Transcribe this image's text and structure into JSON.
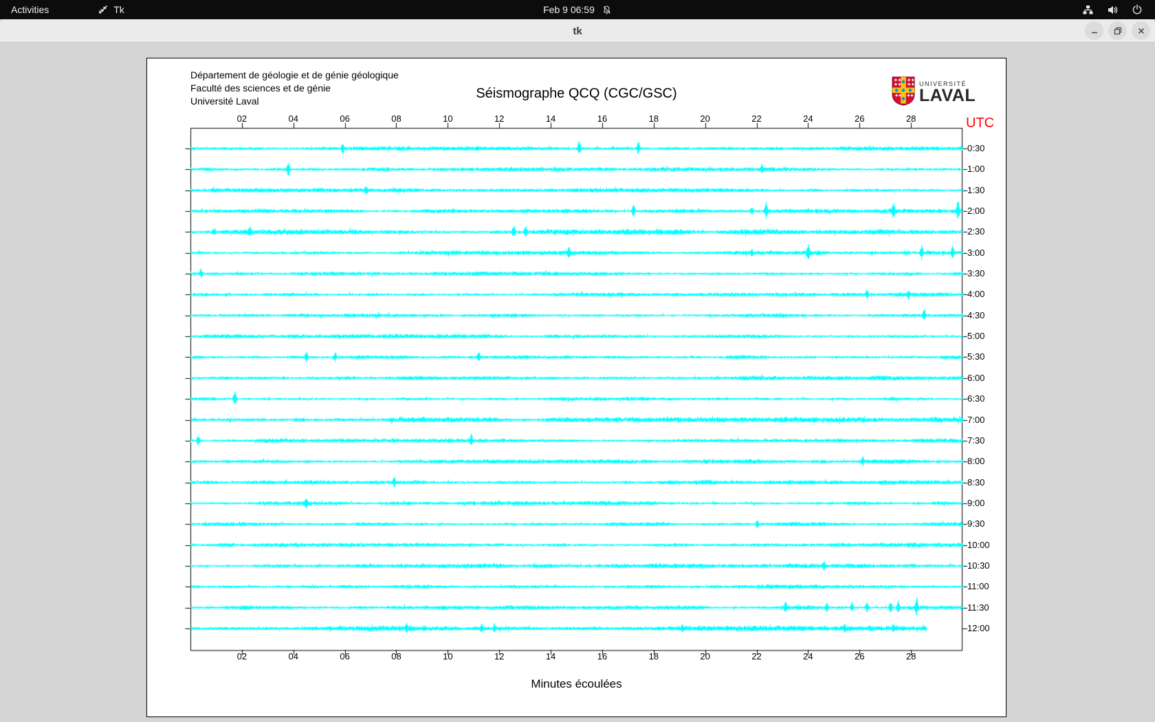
{
  "top_bar": {
    "activities_label": "Activities",
    "app_indicator_label": "Tk",
    "clock": "Feb 9  06:59",
    "icons": {
      "app": "tk-app-icon",
      "notifications": "bell-slash-icon",
      "network": "network-tree-icon",
      "volume": "speaker-icon",
      "power": "power-icon"
    }
  },
  "title_bar": {
    "title": "tk",
    "buttons": [
      "minimize",
      "maximize",
      "close"
    ]
  },
  "page": {
    "institution_lines": [
      "Département de géologie et de génie géologique",
      "Faculté des sciences et de génie",
      "Université Laval"
    ],
    "title": "Séismographe QCQ (CGC/GSC)",
    "utc_label": "UTC",
    "x_axis_label": "Minutes écoulées",
    "logo": {
      "top_text": "UNIVERSITÉ",
      "bottom_text": "LAVAL",
      "colors": {
        "red": "#d21034",
        "yellow": "#ffc20e",
        "blue": "#0096d6",
        "text": "#2a2628"
      }
    }
  },
  "colors": {
    "trace_cyan": "#00ffff",
    "utc_red": "#ff0000",
    "axis_black": "#000000",
    "topbar_bg": "#0c0c0c",
    "titlebar_bg": "#ebebeb",
    "desktop_bg": "#d5d5d5"
  },
  "chart_data": {
    "type": "line",
    "title": "Séismographe QCQ (CGC/GSC)",
    "xlabel": "Minutes écoulées",
    "right_axis_label": "UTC",
    "x_range_minutes": [
      0,
      30
    ],
    "x_tick_minutes": [
      2,
      4,
      6,
      8,
      10,
      12,
      14,
      16,
      18,
      20,
      22,
      24,
      26,
      28
    ],
    "x_tick_labels": [
      "02",
      "04",
      "06",
      "08",
      "10",
      "12",
      "14",
      "16",
      "18",
      "20",
      "22",
      "24",
      "26",
      "28"
    ],
    "row_interval_minutes": 30,
    "trace_color": "#00ffff",
    "rows": [
      {
        "time": "0:30",
        "events": [
          [
            5.9,
            8
          ],
          [
            15.1,
            10
          ],
          [
            17.4,
            9
          ]
        ]
      },
      {
        "time": "1:00",
        "events": [
          [
            3.8,
            10
          ],
          [
            22.2,
            7
          ]
        ]
      },
      {
        "time": "1:30",
        "events": [
          [
            6.8,
            8
          ]
        ]
      },
      {
        "time": "2:00",
        "events": [
          [
            17.2,
            9
          ],
          [
            21.8,
            6
          ],
          [
            22.35,
            12
          ],
          [
            27.3,
            12
          ],
          [
            29.8,
            14
          ]
        ]
      },
      {
        "time": "2:30",
        "ns": 1.25,
        "events": [
          [
            0.9,
            6
          ],
          [
            2.3,
            8
          ],
          [
            12.55,
            10
          ],
          [
            13.0,
            9
          ]
        ]
      },
      {
        "time": "3:00",
        "events": [
          [
            14.7,
            8
          ],
          [
            21.8,
            6
          ],
          [
            24.0,
            14
          ],
          [
            28.4,
            12
          ],
          [
            29.6,
            9
          ]
        ]
      },
      {
        "time": "3:30",
        "events": [
          [
            0.4,
            7
          ]
        ]
      },
      {
        "time": "4:00",
        "events": [
          [
            26.3,
            8
          ],
          [
            27.9,
            8
          ]
        ]
      },
      {
        "time": "4:30",
        "events": [
          [
            28.5,
            9
          ]
        ]
      },
      {
        "time": "5:00",
        "events": []
      },
      {
        "time": "5:30",
        "events": [
          [
            4.5,
            9
          ],
          [
            5.6,
            7
          ],
          [
            11.2,
            8
          ]
        ]
      },
      {
        "time": "6:00",
        "events": []
      },
      {
        "time": "6:30",
        "events": [
          [
            1.7,
            10
          ]
        ]
      },
      {
        "time": "7:00",
        "ns": 1.2,
        "events": []
      },
      {
        "time": "7:30",
        "events": [
          [
            0.3,
            8
          ],
          [
            10.9,
            9
          ]
        ]
      },
      {
        "time": "8:00",
        "events": [
          [
            26.1,
            8
          ]
        ]
      },
      {
        "time": "8:30",
        "events": [
          [
            7.9,
            9
          ]
        ]
      },
      {
        "time": "9:00",
        "events": [
          [
            4.5,
            9
          ]
        ]
      },
      {
        "time": "9:30",
        "events": [
          [
            22.0,
            7
          ]
        ]
      },
      {
        "time": "10:00",
        "events": []
      },
      {
        "time": "10:30",
        "events": [
          [
            24.6,
            7
          ]
        ]
      },
      {
        "time": "11:00",
        "events": []
      },
      {
        "time": "11:30",
        "events": [
          [
            23.1,
            8
          ],
          [
            24.7,
            8
          ],
          [
            25.7,
            7
          ],
          [
            26.3,
            8
          ],
          [
            27.2,
            9
          ],
          [
            27.5,
            9
          ],
          [
            28.2,
            13
          ]
        ]
      },
      {
        "time": "12:00",
        "ns": 1.25,
        "end_minute": 28.6,
        "events": [
          [
            8.4,
            8
          ],
          [
            11.3,
            7
          ],
          [
            11.8,
            7
          ],
          [
            19.1,
            6
          ],
          [
            25.4,
            7
          ],
          [
            27.3,
            7
          ]
        ]
      }
    ]
  }
}
